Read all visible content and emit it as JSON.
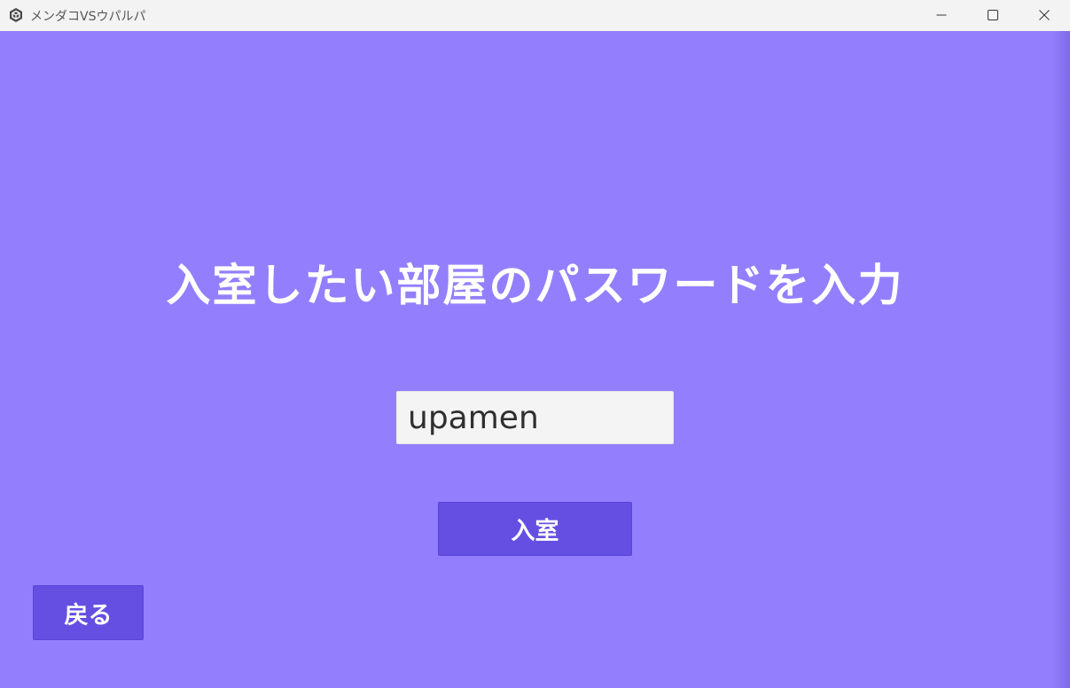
{
  "window": {
    "title": "メンダコVSウパルパ",
    "app_icon": "unity-icon",
    "controls": {
      "minimize_icon": "minimize-icon",
      "maximize_icon": "maximize-icon",
      "close_icon": "close-icon"
    }
  },
  "main": {
    "heading": "入室したい部屋のパスワードを入力",
    "password_input": {
      "value": "upamen",
      "placeholder": ""
    },
    "enter_button_label": "入室",
    "back_button_label": "戻る"
  },
  "colors": {
    "background": "#937ffd",
    "button": "#654fe3",
    "input_bg": "#f4f4f4",
    "text_light": "#ffffff",
    "titlebar": "#f3f3f3"
  }
}
